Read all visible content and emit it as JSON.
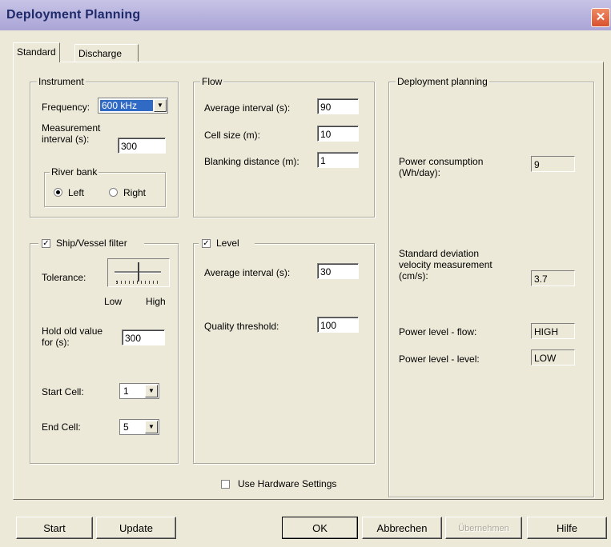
{
  "window": {
    "title": "Deployment Planning"
  },
  "tabs": [
    {
      "label": "Standard"
    },
    {
      "label": "Discharge"
    }
  ],
  "instrument": {
    "legend": "Instrument",
    "frequency_label": "Frequency:",
    "frequency_value": "600 kHz",
    "measurement_label": "Measurement\ninterval (s):",
    "measurement_value": "300",
    "river_bank": {
      "legend": "River bank",
      "left_label": "Left",
      "right_label": "Right",
      "selected": "Left"
    }
  },
  "flow": {
    "legend": "Flow",
    "avg_interval_label": "Average interval (s):",
    "avg_interval_value": "90",
    "cell_size_label": "Cell size (m):",
    "cell_size_value": "10",
    "blanking_label": "Blanking distance (m):",
    "blanking_value": "1"
  },
  "ship_filter": {
    "legend": "Ship/Vessel filter",
    "checked": true,
    "tolerance_label": "Tolerance:",
    "slider_low": "Low",
    "slider_high": "High",
    "hold_label": "Hold old value\nfor (s):",
    "hold_value": "300",
    "start_cell_label": "Start Cell:",
    "start_cell_value": "1",
    "end_cell_label": "End Cell:",
    "end_cell_value": "5"
  },
  "level": {
    "legend": "Level",
    "checked": true,
    "avg_interval_label": "Average interval (s):",
    "avg_interval_value": "30",
    "quality_label": "Quality threshold:",
    "quality_value": "100"
  },
  "deployment": {
    "legend": "Deployment planning",
    "power_consumption_label": "Power consumption\n(Wh/day):",
    "power_consumption_value": "9",
    "std_dev_label": "Standard deviation\nvelocity measurement\n(cm/s):",
    "std_dev_value": "3.7",
    "power_flow_label": "Power level - flow:",
    "power_flow_value": "HIGH",
    "power_level_label": "Power level - level:",
    "power_level_value": "LOW"
  },
  "hardware": {
    "label": "Use Hardware Settings",
    "checked": false
  },
  "buttons": {
    "start": "Start",
    "update": "Update",
    "ok": "OK",
    "cancel": "Abbrechen",
    "apply": "Übernehmen",
    "help": "Hilfe"
  },
  "icons": {
    "close": "close-icon",
    "dropdown": "chevron-down-icon",
    "check": "check-icon"
  }
}
